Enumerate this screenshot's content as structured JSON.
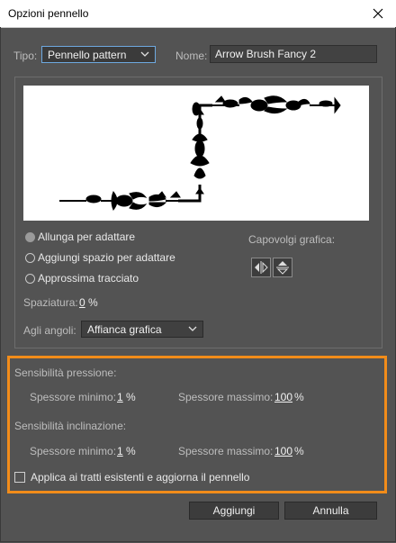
{
  "window": {
    "title": "Opzioni pennello"
  },
  "tipo": {
    "label": "Tipo:",
    "value": "Pennello pattern"
  },
  "nome": {
    "label": "Nome:",
    "value": "Arrow Brush Fancy 2"
  },
  "fit": {
    "options": [
      {
        "label": "Allunga per adattare",
        "checked": true
      },
      {
        "label": "Aggiungi spazio per adattare",
        "checked": false
      },
      {
        "label": "Approssima tracciato",
        "checked": false
      }
    ]
  },
  "flip": {
    "label": "Capovolgi grafica:"
  },
  "spacing": {
    "label": "Spaziatura:",
    "value": "0",
    "unit": "%"
  },
  "corners": {
    "label": "Agli angoli:",
    "value": "Affianca grafica"
  },
  "pressure": {
    "title": "Sensibilità pressione:",
    "min_label": "Spessore minimo:",
    "min_value": "1",
    "min_unit": "%",
    "max_label": "Spessore massimo:",
    "max_value": "100",
    "max_unit": "%"
  },
  "tilt": {
    "title": "Sensibilità inclinazione:",
    "min_label": "Spessore minimo:",
    "min_value": "1",
    "min_unit": "%",
    "max_label": "Spessore massimo:",
    "max_value": "100",
    "max_unit": "%"
  },
  "apply_existing": {
    "label": "Applica ai tratti esistenti e aggiorna il pennello",
    "checked": false
  },
  "buttons": {
    "add": "Aggiungi",
    "cancel": "Annulla"
  },
  "colors": {
    "highlight": "#f28c1a",
    "focus": "#6ea9e0",
    "dialog_bg": "#535353"
  }
}
